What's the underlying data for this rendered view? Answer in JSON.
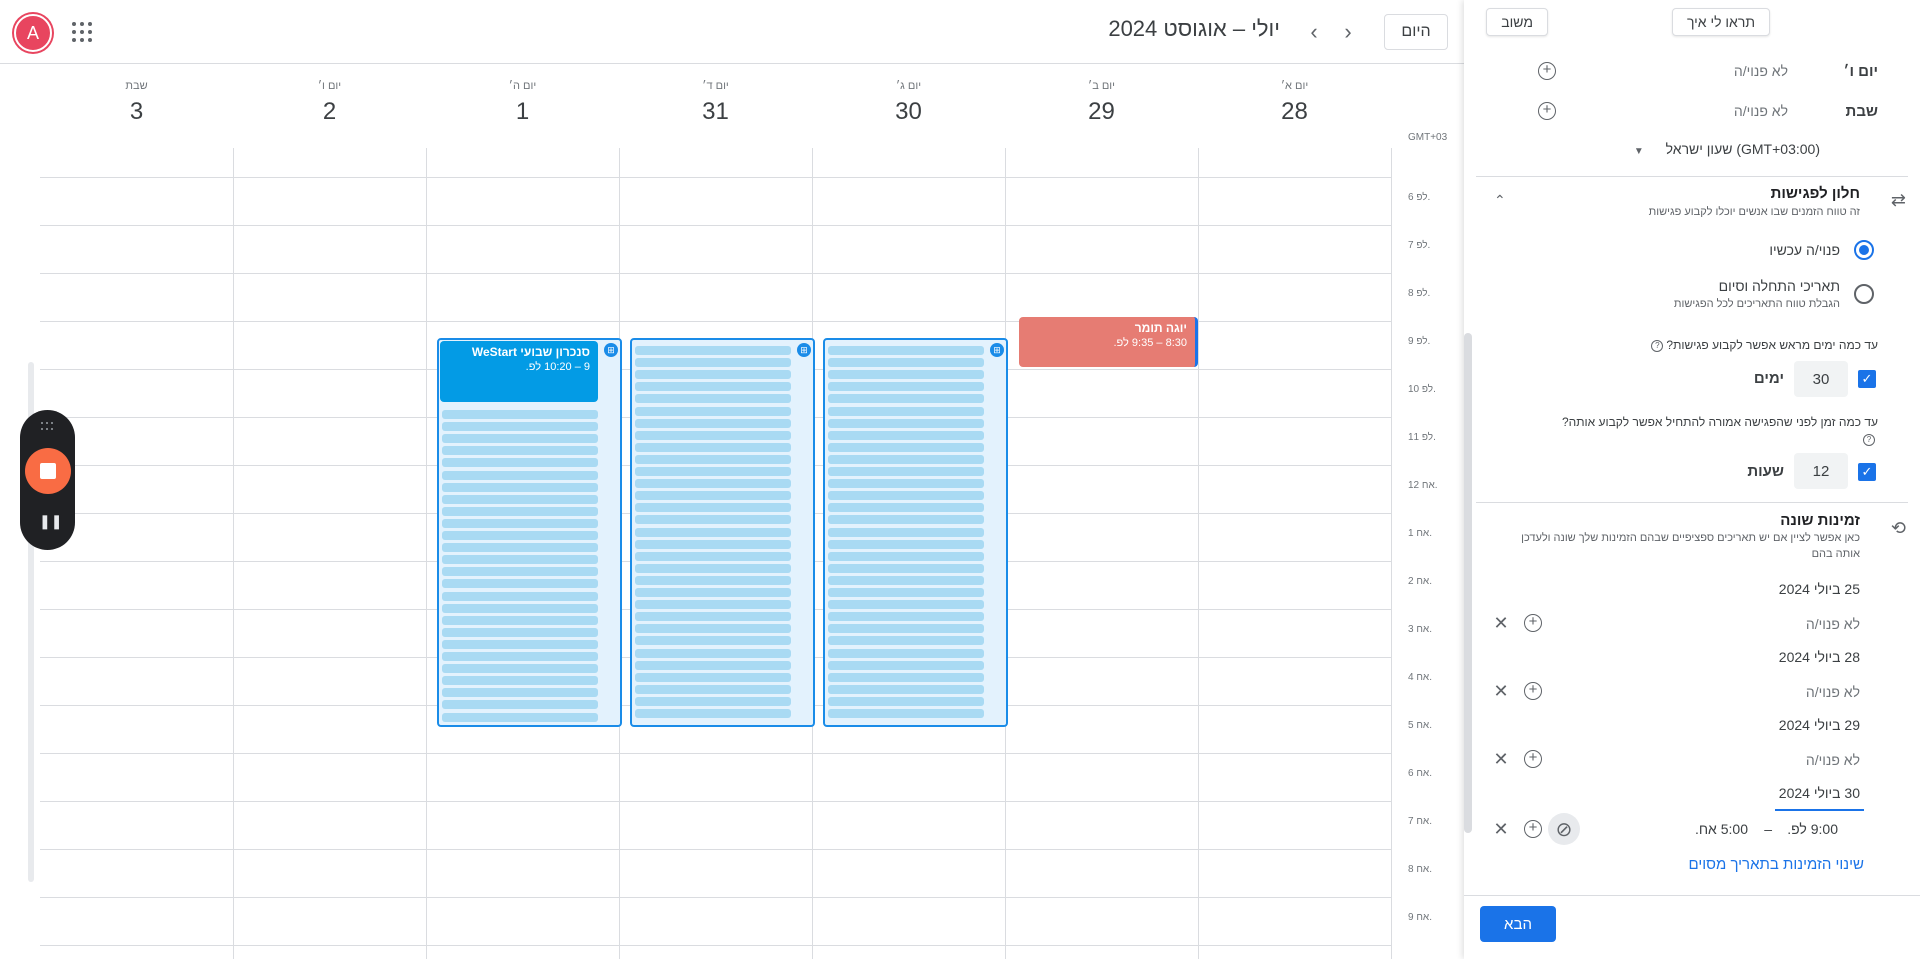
{
  "user": {
    "avatar_letter": "A"
  },
  "header": {
    "title": "יולי – אוגוסט 2024",
    "today_label": "היום",
    "prev": "‹",
    "next": "›"
  },
  "days": [
    {
      "name": "יום א׳",
      "date": "28"
    },
    {
      "name": "יום ב׳",
      "date": "29"
    },
    {
      "name": "יום ג׳",
      "date": "30"
    },
    {
      "name": "יום ד׳",
      "date": "31"
    },
    {
      "name": "יום ה׳",
      "date": "1"
    },
    {
      "name": "יום ו׳",
      "date": "2"
    },
    {
      "name": "שבת",
      "date": "3"
    }
  ],
  "timezone_label": "GMT+03",
  "time_labels": [
    "6 לפ.",
    "7 לפ.",
    "8 לפ.",
    "9 לפ.",
    "10 לפ.",
    "11 לפ.",
    "12 אח.",
    "1 אח.",
    "2 אח.",
    "3 אח.",
    "4 אח.",
    "5 אח.",
    "6 אח.",
    "7 אח.",
    "8 אח.",
    "9 אח."
  ],
  "events": [
    {
      "title": "יוגה תומר",
      "time": "8:30 – 9:35 לפ.",
      "color": "#e67c73"
    },
    {
      "title": "סנכרון שבועי WeStart",
      "time": "9 – 10:20 לפ.",
      "color": "#039be5"
    }
  ],
  "panel": {
    "tip_left": "משוב",
    "tip_right": "תראו לי איך",
    "weekday_rows": [
      {
        "day": "יום ו׳",
        "status": "לא פנוי/ה"
      },
      {
        "day": "שבת",
        "status": "לא פנוי/ה"
      }
    ],
    "timezone": "(GMT+03:00) שעון ישראל",
    "window": {
      "title": "חלון לפגישות",
      "subtitle": "זה טווח הזמנים שבו אנשים יוכלו לקבוע פגישות"
    },
    "radio_now": "פנוי/ה עכשיו",
    "radio_dates": "תאריכי התחלה וסיום",
    "radio_dates_sub": "הגבלת טווח התאריכים לכל הפגישות",
    "q_days": "עד כמה ימים מראש אפשר לקבוע פגישות?",
    "days_value": "30",
    "days_unit": "ימים",
    "q_hours": "עד כמה זמן לפני שהפגישה אמורה להתחיל אפשר לקבוע אותה?",
    "hours_value": "12",
    "hours_unit": "שעות",
    "changed": {
      "title": "זמינות שונה",
      "subtitle": "כאן אפשר לציין אם יש תאריכים ספציפיים שבהם הזמינות שלך שונה ולעדכן אותה בהם"
    },
    "overrides": [
      {
        "date": "25 ביולי 2024",
        "status": "לא פנוי/ה"
      },
      {
        "date": "28 ביולי 2024",
        "status": "לא פנוי/ה"
      },
      {
        "date": "29 ביולי 2024",
        "status": "לא פנוי/ה"
      }
    ],
    "active_override": {
      "date": "30 ביולי 2024",
      "start": "9:00 לפ.",
      "dash": "–",
      "end": "5:00 אח."
    },
    "change_link": "שינוי הזמינות בתאריך מסוים",
    "next_label": "הבא"
  }
}
